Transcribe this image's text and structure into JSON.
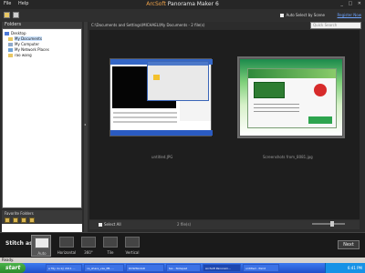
{
  "menu": {
    "file": "File",
    "help": "Help"
  },
  "title": {
    "brand": "ArcSoft",
    "rest": " Panorama Maker 6"
  },
  "topbar": {
    "auto_select": "Auto Select by Scene",
    "register": "Register Now"
  },
  "folders": {
    "header": "Folders",
    "items": [
      {
        "label": "Desktop"
      },
      {
        "label": "My Documents"
      },
      {
        "label": "My Computer"
      },
      {
        "label": "My Network Places"
      },
      {
        "label": "rao wang"
      }
    ]
  },
  "favorites": {
    "header": "Favorite Folders"
  },
  "path": {
    "text": "C:\\Documents and Settings\\MICHAEL\\My Documents - 2 file(s)",
    "search_placeholder": "Quick Search"
  },
  "gallery": {
    "items": [
      {
        "caption": "untitled.JPG"
      },
      {
        "caption": "Screenshots from_8081.jpg"
      }
    ]
  },
  "gallery_footer": {
    "select_all": "Select All",
    "files": "2 file(s)"
  },
  "stitch": {
    "label": "Stitch as:",
    "modes": [
      {
        "label": "Auto"
      },
      {
        "label": "Horizontal"
      },
      {
        "label": "360°"
      },
      {
        "label": "Tile"
      },
      {
        "label": "Vertical"
      }
    ],
    "next": "Next"
  },
  "status": "Ready.",
  "taskbar": {
    "start": "start",
    "items": [
      "e Tây du ký 2011 ...",
      "ce_share_vas_PB- ...",
      "DOWNLOAD",
      "tes - Notepad",
      "ArcSoft Panoram...",
      "untitled - Paint"
    ],
    "clock": "6:41 PM"
  }
}
